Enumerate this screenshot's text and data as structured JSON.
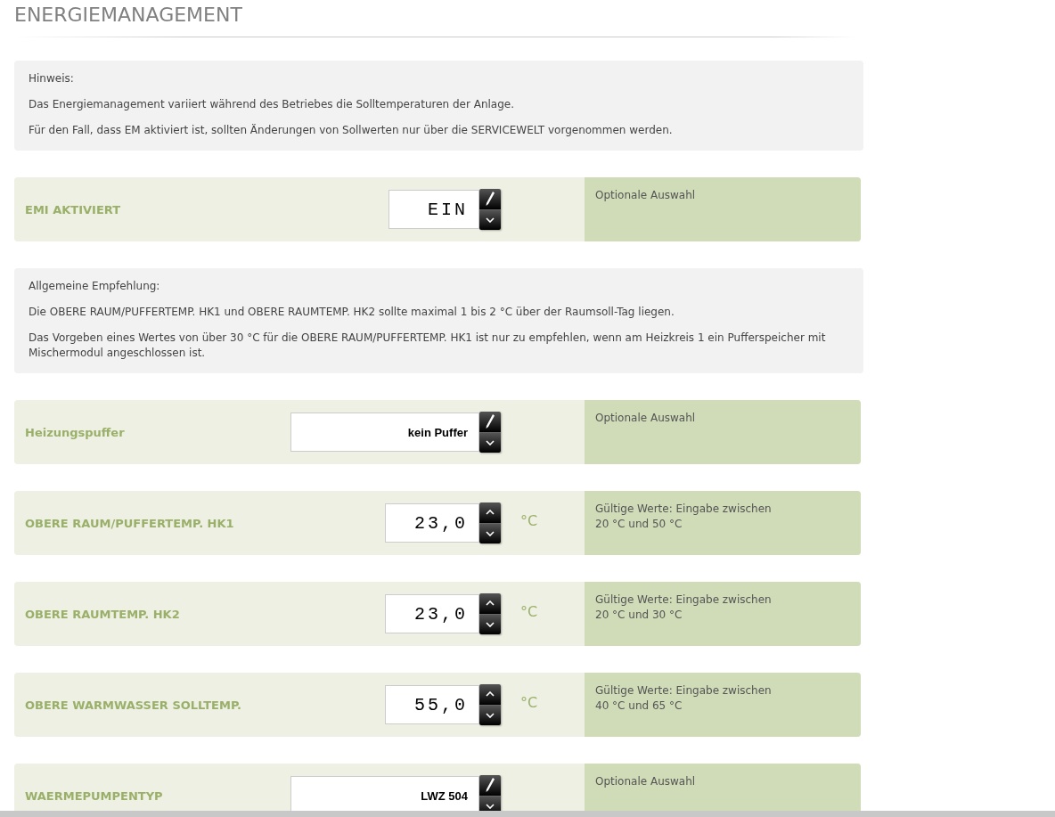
{
  "title": "ENERGIEMANAGEMENT",
  "sections": [
    {
      "kind": "notice",
      "lines": [
        "Hinweis:",
        "Das Energiemanagement variiert während des Betriebes die Solltemperaturen der Anlage.",
        "Für den Fall, dass EM aktiviert ist, sollten Änderungen von Sollwerten nur über die SERVICEWELT vorgenommen werden."
      ]
    },
    {
      "kind": "switch",
      "label": "EMI AKTIVIERT",
      "value": "EIN",
      "info": "Optionale Auswahl"
    },
    {
      "kind": "notice",
      "lines": [
        "Allgemeine Empfehlung:",
        "Die OBERE RAUM/PUFFERTEMP. HK1 und OBERE RAUMTEMP. HK2 sollte maximal 1 bis 2 °C über der Raumsoll-Tag liegen.",
        "Das Vorgeben eines Wertes von über 30 °C für die OBERE RAUM/PUFFERTEMP. HK1 ist nur zu empfehlen, wenn am Heizkreis 1 ein Pufferspeicher mit Mischermodul angeschlossen ist."
      ]
    },
    {
      "kind": "select",
      "label": "Heizungspuffer",
      "value": "kein Puffer",
      "info": "Optionale Auswahl"
    },
    {
      "kind": "number",
      "label": "OBERE RAUM/PUFFERTEMP. HK1",
      "value": "23,0",
      "unit": "°C",
      "info": "Gültige Werte: Eingabe zwischen 20 °C und 50 °C"
    },
    {
      "kind": "number",
      "label": "OBERE RAUMTEMP. HK2",
      "value": "23,0",
      "unit": "°C",
      "info": "Gültige Werte: Eingabe zwischen 20 °C und 30 °C"
    },
    {
      "kind": "number",
      "label": "OBERE WARMWASSER SOLLTEMP.",
      "value": "55,0",
      "unit": "°C",
      "info": "Gültige Werte: Eingabe zwischen 40 °C und 65 °C"
    },
    {
      "kind": "select",
      "label": "WAERMEPUMPENTYP",
      "value": "LWZ 504",
      "info": "Optionale Auswahl"
    }
  ]
}
